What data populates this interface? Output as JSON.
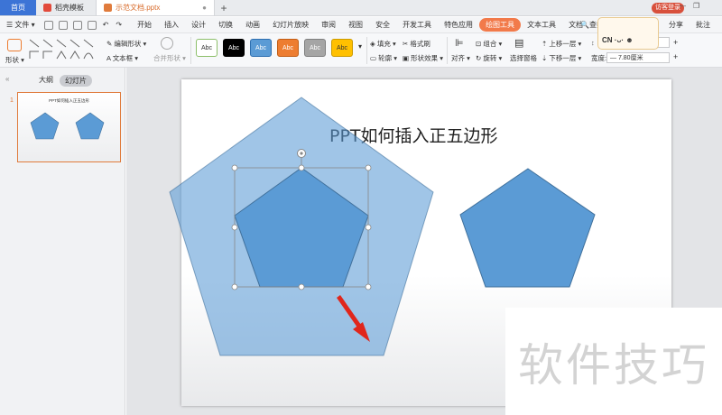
{
  "tabs": {
    "home": "首页",
    "docer": "稻壳模板",
    "document": "示范文档.pptx"
  },
  "visitor_label": "访客登录",
  "menu": {
    "file": "文件",
    "items": [
      "开始",
      "插入",
      "设计",
      "切换",
      "动画",
      "幻灯片放映",
      "审阅",
      "视图",
      "安全",
      "开发工具",
      "特色应用",
      "绘图工具",
      "文本工具",
      "文档"
    ],
    "active_index": 11,
    "share": "分享",
    "annotate": "批注",
    "search": "查找"
  },
  "ribbon": {
    "shape": "形状",
    "edit_shape": "编辑形状",
    "text_box": "文本框",
    "merge_shape": "合并形状",
    "styles": [
      {
        "label": "Abc",
        "bg": "#ffffff",
        "fg": "#333333",
        "border": "#8dbf6a"
      },
      {
        "label": "Abc",
        "bg": "#000000",
        "fg": "#ffffff",
        "border": "#000000"
      },
      {
        "label": "Abc",
        "bg": "#5b9bd5",
        "fg": "#ffffff",
        "border": "#2e6fb0"
      },
      {
        "label": "Abc",
        "bg": "#ed7d31",
        "fg": "#ffffff",
        "border": "#c25f17"
      },
      {
        "label": "Abc",
        "bg": "#a5a5a5",
        "fg": "#ffffff",
        "border": "#7f7f7f"
      },
      {
        "label": "Abc",
        "bg": "#ffc000",
        "fg": "#333333",
        "border": "#cc9a00"
      }
    ],
    "fill": "填充",
    "format_brush": "格式刷",
    "outline": "轮廓",
    "shape_effect": "形状效果",
    "align": "对齐",
    "group": "组合",
    "rotate": "旋转",
    "selection_pane": "选择窗格",
    "bring_forward": "上移一层",
    "send_backward": "下移一层",
    "width_label": "宽度:",
    "width_value": "7.80厘米"
  },
  "left_pane": {
    "outline_tab": "大纲",
    "slides_tab": "幻灯片",
    "slide_number": "1",
    "thumb_title": "PPT如何插入正五边形"
  },
  "slide": {
    "title": "PPT如何插入正五边形"
  },
  "mascot_text": "CN",
  "watermark": "软件技巧",
  "colors": {
    "pentagon_fill": "#5b9bd5",
    "pentagon_stroke": "#41719c",
    "large_pentagon_fill": "#9fc1e4",
    "arrow": "#e0261b",
    "accent_tab": "#f27a4a",
    "home_tab": "#3c74d6"
  }
}
